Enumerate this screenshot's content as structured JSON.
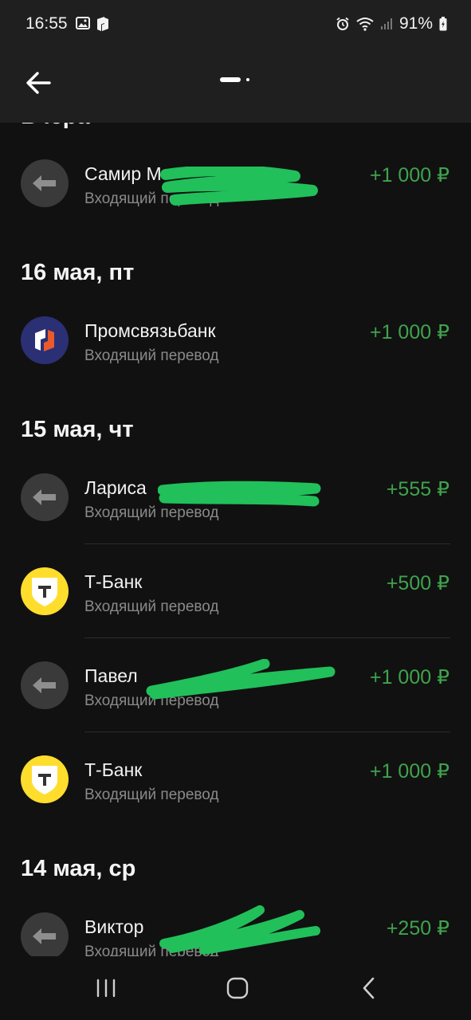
{
  "status_bar": {
    "time": "16:55",
    "battery": "91%"
  },
  "header": {
    "back_icon": "arrow-left-icon"
  },
  "feed": {
    "partial_header": "Вчера",
    "groups": [
      {
        "date": "",
        "items": [
          {
            "name": "Самир М",
            "subtitle": "Входящий перевод",
            "amount": "+1 000 ₽",
            "avatar": "transfer-arrow-icon"
          }
        ]
      },
      {
        "date": "16 мая, пт",
        "items": [
          {
            "name": "Промсвязьбанк",
            "subtitle": "Входящий перевод",
            "amount": "+1 000 ₽",
            "avatar": "psb-logo-icon"
          }
        ]
      },
      {
        "date": "15 мая, чт",
        "items": [
          {
            "name": "Лариса",
            "subtitle": "Входящий перевод",
            "amount": "+555 ₽",
            "avatar": "transfer-arrow-icon"
          },
          {
            "name": "Т-Банк",
            "subtitle": "Входящий перевод",
            "amount": "+500 ₽",
            "avatar": "tbank-logo-icon"
          },
          {
            "name": "Павел",
            "subtitle": "Входящий перевод",
            "amount": "+1 000 ₽",
            "avatar": "transfer-arrow-icon"
          },
          {
            "name": "Т-Банк",
            "subtitle": "Входящий перевод",
            "amount": "+1 000 ₽",
            "avatar": "tbank-logo-icon"
          }
        ]
      },
      {
        "date": "14 мая, ср",
        "items": [
          {
            "name": "Виктор",
            "subtitle": "Входящий перевод",
            "amount": "+250 ₽",
            "avatar": "transfer-arrow-icon"
          }
        ]
      }
    ]
  },
  "colors": {
    "background": "#111111",
    "header_bg": "#1f1f1f",
    "amount_green": "#3fa34d",
    "subtitle_gray": "#8a8a8a",
    "tbank_yellow": "#ffdd2d",
    "psb_blue": "#2b2f74",
    "redaction_green": "#21c05a"
  },
  "navbar": {
    "recent_icon": "recent-apps-icon",
    "home_icon": "home-icon",
    "back_icon": "nav-back-icon"
  }
}
